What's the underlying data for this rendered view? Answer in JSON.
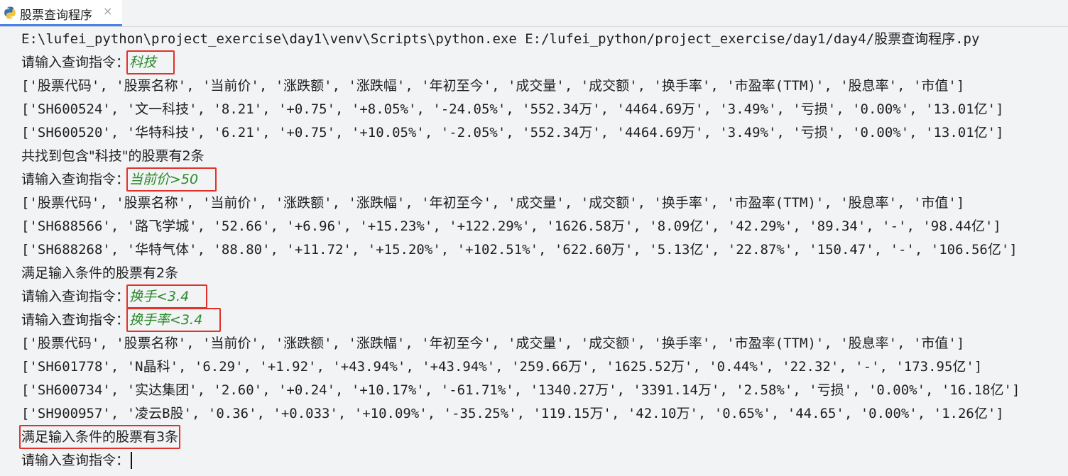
{
  "tab": {
    "title": "股票查询程序",
    "close": "×",
    "icon": "python-icon"
  },
  "console": {
    "lines": [
      {
        "text": "E:\\lufei_python\\project_exercise\\day1\\venv\\Scripts\\python.exe E:/lufei_python/project_exercise/day1/day4/股票查询程序.py"
      },
      {
        "prompt": "请输入查询指令：",
        "input": "科技"
      },
      {
        "text": "['股票代码', '股票名称', '当前价', '涨跌额', '涨跌幅', '年初至今', '成交量', '成交额', '换手率', '市盈率(TTM)', '股息率', '市值']"
      },
      {
        "text": "['SH600524', '文一科技', '8.21', '+0.75', '+8.05%', '-24.05%', '552.34万', '4464.69万', '3.49%', '亏损', '0.00%', '13.01亿']"
      },
      {
        "text": "['SH600520', '华特科技', '6.21', '+0.75', '+10.05%', '-2.05%', '552.34万', '4464.69万', '3.49%', '亏损', '0.00%', '13.01亿']"
      },
      {
        "text": "共找到包含\"科技\"的股票有2条"
      },
      {
        "prompt": "请输入查询指令：",
        "input": "当前价>50"
      },
      {
        "text": "['股票代码', '股票名称', '当前价', '涨跌额', '涨跌幅', '年初至今', '成交量', '成交额', '换手率', '市盈率(TTM)', '股息率', '市值']"
      },
      {
        "text": "['SH688566', '路飞学城', '52.66', '+6.96', '+15.23%', '+122.29%', '1626.58万', '8.09亿', '42.29%', '89.34', '-', '98.44亿']"
      },
      {
        "text": "['SH688268', '华特气体', '88.80', '+11.72', '+15.20%', '+102.51%', '622.60万', '5.13亿', '22.87%', '150.47', '-', '106.56亿']"
      },
      {
        "text": "满足输入条件的股票有2条"
      },
      {
        "prompt": "请输入查询指令：",
        "input": "换手<3.4"
      },
      {
        "prompt": "请输入查询指令：",
        "input": "换手率<3.4"
      },
      {
        "text": "['股票代码', '股票名称', '当前价', '涨跌额', '涨跌幅', '年初至今', '成交量', '成交额', '换手率', '市盈率(TTM)', '股息率', '市值']"
      },
      {
        "text": "['SH601778', 'N晶科', '6.29', '+1.92', '+43.94%', '+43.94%', '259.66万', '1625.52万', '0.44%', '22.32', '-', '173.95亿']"
      },
      {
        "text": "['SH600734', '实达集团', '2.60', '+0.24', '+10.17%', '-61.71%', '1340.27万', '3391.14万', '2.58%', '亏损', '0.00%', '16.18亿']"
      },
      {
        "text": "['SH900957', '凌云B股', '0.36', '+0.033', '+10.09%', '-35.25%', '119.15万', '42.10万', '0.65%', '44.65', '0.00%', '1.26亿']"
      },
      {
        "text": "满足输入条件的股票有3条"
      },
      {
        "prompt": "请输入查询指令：",
        "input": ""
      }
    ]
  },
  "colors": {
    "background": "#f2f3f5",
    "input_text": "#2a8a2a",
    "highlight_box": "#e0322b",
    "tab_underline": "#4a83e8"
  }
}
